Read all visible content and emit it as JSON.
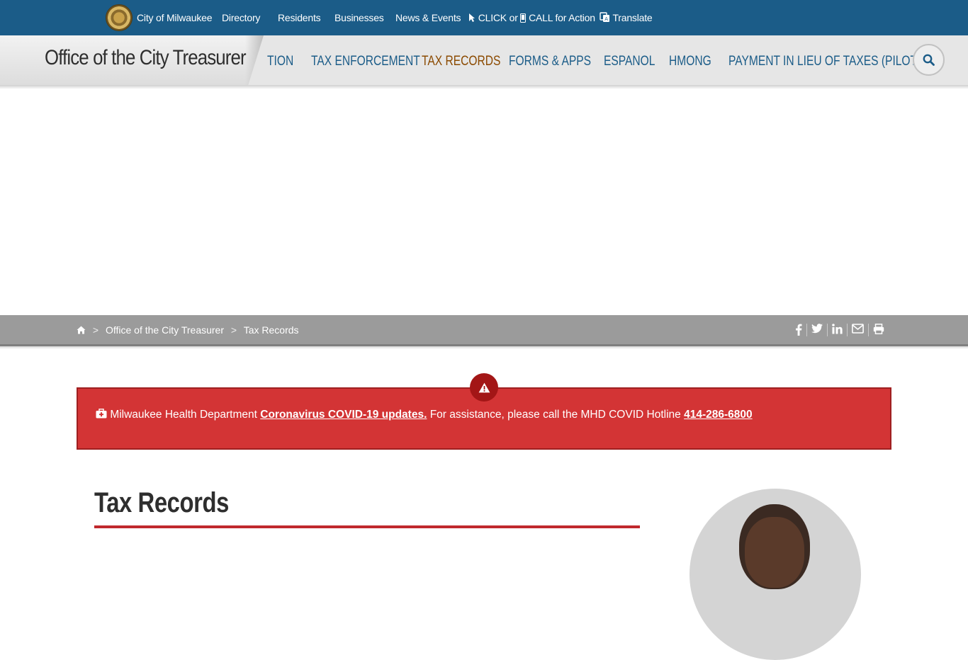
{
  "topbar": {
    "site_label": "City of Milwaukee",
    "links": [
      "Directory",
      "Residents",
      "Businesses",
      "News & Events"
    ],
    "cfa_click": "CLICK or",
    "cfa_call": "CALL for Action",
    "translate": "Translate"
  },
  "subnav": {
    "office_title": "Office of the City Treasurer",
    "partial_item": "TION",
    "items": [
      "TAX ENFORCEMENT",
      "TAX RECORDS",
      "FORMS & APPS",
      "ESPANOL",
      "HMONG",
      "PAYMENT IN LIEU OF TAXES (PILOT)"
    ],
    "active_item": "TAX RECORDS"
  },
  "breadcrumb": {
    "home_icon": "home-icon",
    "items": [
      "Office of the City Treasurer",
      "Tax Records"
    ],
    "separator": ">"
  },
  "share": [
    "facebook-icon",
    "twitter-icon",
    "linkedin-icon",
    "email-icon",
    "print-icon"
  ],
  "alert": {
    "prefix": "Milwaukee Health Department",
    "link_text": "Coronavirus COVID-19 updates.",
    "middle": "For assistance, please call the MHD COVID Hotline",
    "phone": "414-286-6800"
  },
  "page": {
    "title": "Tax Records"
  },
  "colors": {
    "topbar": "#1b5c88",
    "nav_link": "#1b5c88",
    "nav_active": "#8b4a00",
    "alert_bg": "#d33435",
    "title_rule": "#c0282d"
  }
}
